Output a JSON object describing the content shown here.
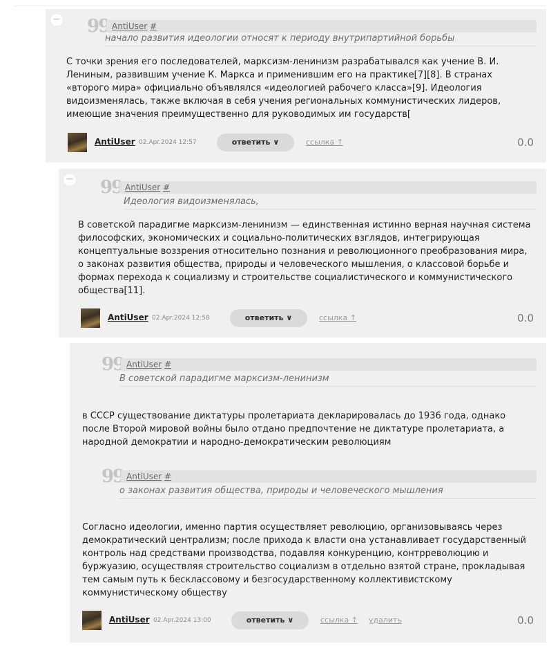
{
  "comments": [
    {
      "quote": {
        "author": "AntiUser",
        "hash": "#",
        "text": "начало развития идеологии относят к периоду внутрипартийной борьбы"
      },
      "body": "С точки зрения его последователей, марксизм-ленинизм разрабатывался как учение В. И. Лениным, развившим учение К. Маркса и применившим его на практике[7][8]. В странах «второго мира» официально объявлялся «идеологией рабочего класса»[9]. Идеология видоизменялась, также включая в себя учения региональных коммунистических лидеров, имеющие значения преимущественно для руководимых им государств[",
      "author": "AntiUser",
      "date": "02.Apr.2024 12:57",
      "reply_label": "ответить",
      "link_label": "ссылка",
      "score": "0.0",
      "collapse_label": "−"
    },
    {
      "quote": {
        "author": "AntiUser",
        "hash": "#",
        "text": "Идеология видоизменялась,"
      },
      "body": "В советской парадигме марксизм-ленинизм — единственная истинно верная научная система философских, экономических и социально-политических взглядов, интегрирующая концептуальные воззрения относительно познания и революционного преобразования мира, о законах развития общества, природы и человеческого мышления, о классовой борьбе и формах перехода к социализму и строительстве социалистического и коммунистического общества[11].",
      "author": "AntiUser",
      "date": "02.Apr.2024 12:58",
      "reply_label": "ответить",
      "link_label": "ссылка",
      "score": "0.0",
      "collapse_label": "−"
    },
    {
      "quote": {
        "author": "AntiUser",
        "hash": "#",
        "text": "В советской парадигме марксизм-ленинизм"
      },
      "body": "в СССР существование диктатуры пролетариата декларировалась до 1936 года, однако после Второй мировой войны было отдано предпочтение не диктатуре пролетариата, а народной демократии и народно-демократическим революциям",
      "quote2": {
        "author": "AntiUser",
        "hash": "#",
        "text": "о законах развития общества, природы и человеческого мышления"
      },
      "body2": "Согласно идеологии, именно партия осуществляет революцию, организовываясь через демократический централизм; после прихода к власти она устанавливает государственный контроль над средствами производства, подавляя конкуренцию, контрреволюцию и буржуазию, осуществляя строительство социализм в отдельно взятой стране, прокладывая тем самым путь к бесклассовому и безгосударственному коллективистскому коммунистическому обществу",
      "author": "AntiUser",
      "date": "02.Apr.2024 13:00",
      "reply_label": "ответить",
      "link_label": "ссылка",
      "delete_label": "удалить",
      "score": "0.0"
    }
  ],
  "icons": {
    "quote": "quote-icon",
    "chevron": "chevron-down-icon",
    "arrow": "arrow-up-icon",
    "avatar": "avatar"
  }
}
